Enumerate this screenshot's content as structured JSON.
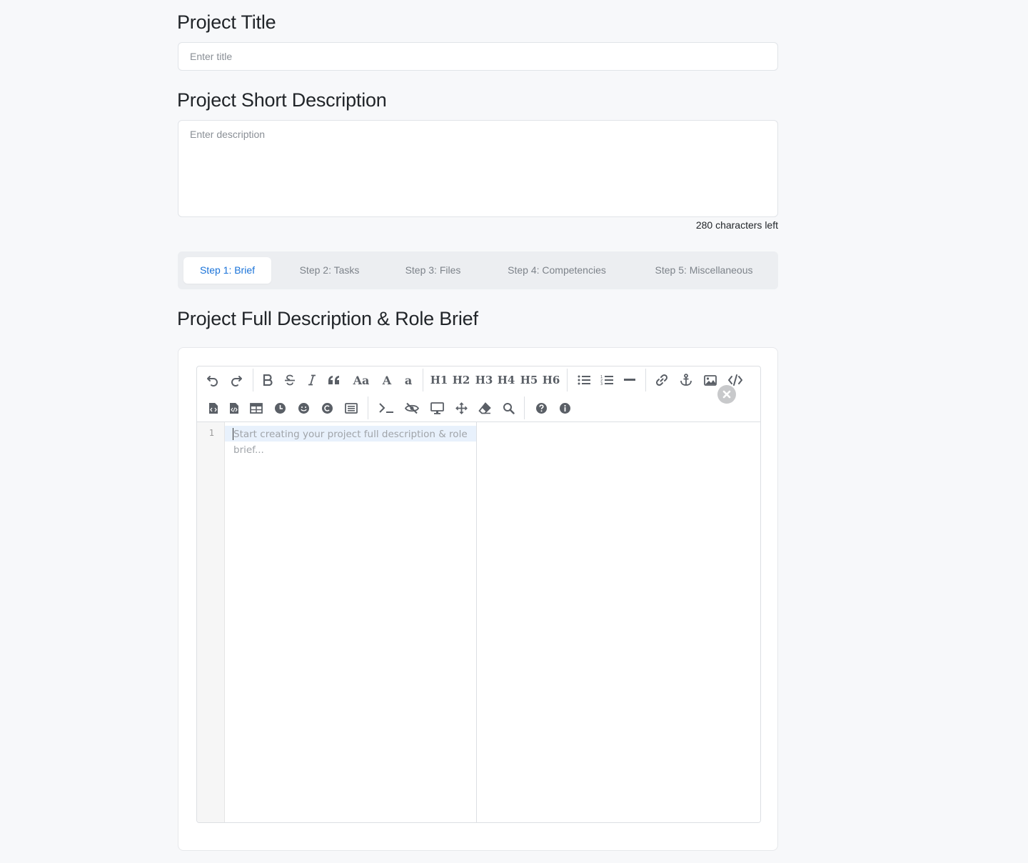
{
  "title_section": {
    "heading": "Project Title",
    "placeholder": "Enter title"
  },
  "short_desc_section": {
    "heading": "Project Short Description",
    "placeholder": "Enter description",
    "chars_left": "280 characters left"
  },
  "steps": [
    {
      "label": "Step 1: Brief",
      "active": true
    },
    {
      "label": "Step 2: Tasks",
      "active": false
    },
    {
      "label": "Step 3: Files",
      "active": false
    },
    {
      "label": "Step 4: Competencies",
      "active": false
    },
    {
      "label": "Step 5: Miscellaneous",
      "active": false
    }
  ],
  "full_desc_section": {
    "heading": "Project Full Description & Role Brief"
  },
  "editor": {
    "line_number": "1",
    "placeholder": "Start creating your project full description & role brief...",
    "toolbar_text": {
      "aa": "Aa",
      "big_a": "A",
      "small_a": "a",
      "h1": "H1",
      "h2": "H2",
      "h3": "H3",
      "h4": "H4",
      "h5": "H5",
      "h6": "H6"
    }
  },
  "colors": {
    "accent": "#1a73d9",
    "background": "#f7f8fa",
    "step_bar": "#eceef1"
  }
}
